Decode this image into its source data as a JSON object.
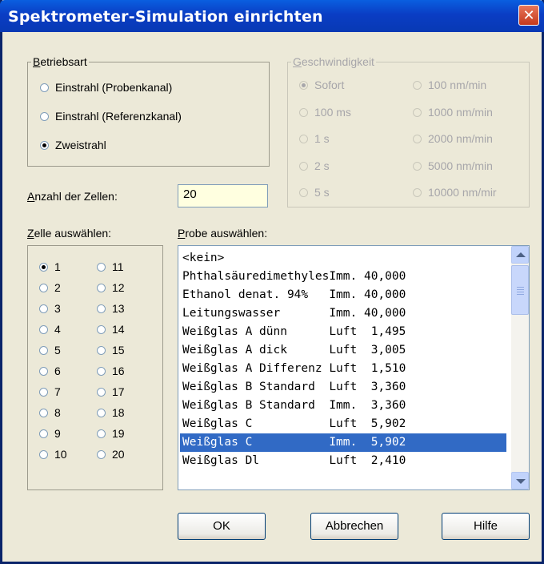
{
  "dialog": {
    "title": "Spektrometer-Simulation einrichten",
    "close_label": "✕"
  },
  "betriebsart": {
    "legend": "Betriebsart",
    "options": [
      "Einstrahl (Probenkanal)",
      "Einstrahl (Referenzkanal)",
      "Zweistrahl"
    ],
    "selected": "Zweistrahl"
  },
  "geschwindigkeit": {
    "legend": "Geschwindigkeit",
    "enabled": false,
    "left_options": [
      "Sofort",
      "100 ms",
      "1 s",
      "2 s",
      "5 s"
    ],
    "right_options": [
      "100 nm/min",
      "1000 nm/min",
      "2000 nm/min",
      "5000 nm/min",
      "10000 nm/mir"
    ],
    "selected": "Sofort"
  },
  "cells": {
    "count_label": "Anzahl der Zellen:",
    "count_value": "20",
    "select_label": "Zelle auswählen:",
    "left_column": [
      "1",
      "2",
      "3",
      "4",
      "5",
      "6",
      "7",
      "8",
      "9",
      "10"
    ],
    "right_column": [
      "11",
      "12",
      "13",
      "14",
      "15",
      "16",
      "17",
      "18",
      "19",
      "20"
    ],
    "selected": "1"
  },
  "probe": {
    "label": "Probe auswählen:",
    "items": [
      "<kein>",
      "PhthalsäuredimethylesImm. 40,000",
      "Ethanol denat. 94%   Imm. 40,000",
      "Leitungswasser       Imm. 40,000",
      "Weißglas A dünn      Luft  1,495",
      "Weißglas A dick      Luft  3,005",
      "Weißglas A Differenz Luft  1,510",
      "Weißglas B Standard  Luft  3,360",
      "Weißglas B Standard  Imm.  3,360",
      "Weißglas C           Luft  5,902",
      "Weißglas C           Imm.  5,902",
      "Weißglas Dl          Luft  2,410"
    ],
    "selected_index": 10
  },
  "buttons": {
    "ok": "OK",
    "cancel": "Abbrechen",
    "help": "Hilfe"
  },
  "colors": {
    "titlebar": "#0A3DC4",
    "face": "#ECE9D8",
    "selection": "#316AC5",
    "input_bg": "#FFFFE0"
  }
}
